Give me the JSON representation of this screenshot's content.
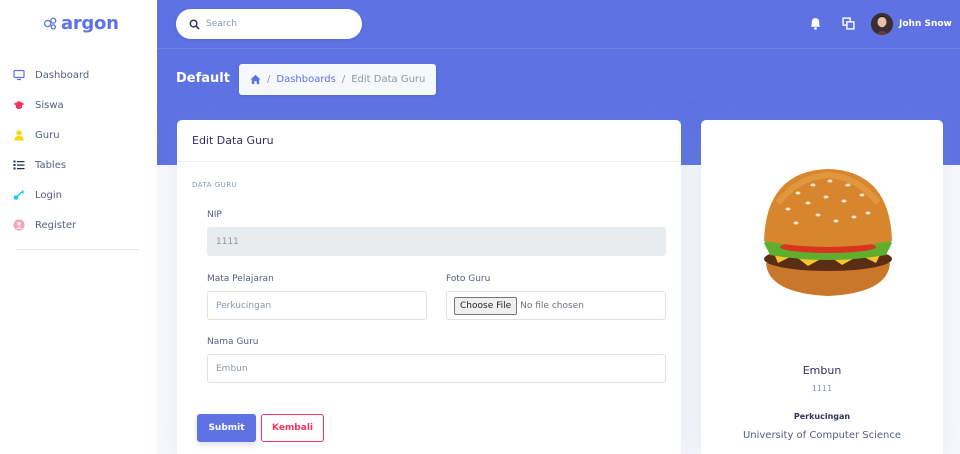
{
  "brand": {
    "name": "argon"
  },
  "sidebar": {
    "items": [
      {
        "label": "Dashboard",
        "icon": "monitor-icon",
        "color": "#5e72e4"
      },
      {
        "label": "Siswa",
        "icon": "graduation-cap-icon",
        "color": "#f5365c"
      },
      {
        "label": "Guru",
        "icon": "user-icon",
        "color": "#ffd600"
      },
      {
        "label": "Tables",
        "icon": "bullet-list-icon",
        "color": "#172b4d"
      },
      {
        "label": "Login",
        "icon": "key-icon",
        "color": "#11cdef"
      },
      {
        "label": "Register",
        "icon": "user-circle-icon",
        "color": "#f3a4b5"
      }
    ]
  },
  "header": {
    "search_placeholder": "Search",
    "user_name": "John Snow",
    "page_title": "Default",
    "breadcrumb": {
      "link": "Dashboards",
      "current": "Edit Data Guru"
    }
  },
  "form": {
    "title": "Edit Data Guru",
    "section": "DATA GURU",
    "nip_label": "NIP",
    "nip_value": "1111",
    "mapel_label": "Mata Pelajaran",
    "mapel_value": "Perkucingan",
    "foto_label": "Foto Guru",
    "file_button": "Choose File",
    "file_status": "No file chosen",
    "nama_label": "Nama Guru",
    "nama_value": "Embun",
    "submit_label": "Submit",
    "back_label": "Kembali"
  },
  "profile": {
    "name": "Embun",
    "nip": "1111",
    "subject": "Perkucingan",
    "school": "University of Computer Science"
  },
  "colors": {
    "primary": "#5e72e4",
    "danger": "#f5365c",
    "text": "#32325d",
    "muted": "#8898aa"
  }
}
